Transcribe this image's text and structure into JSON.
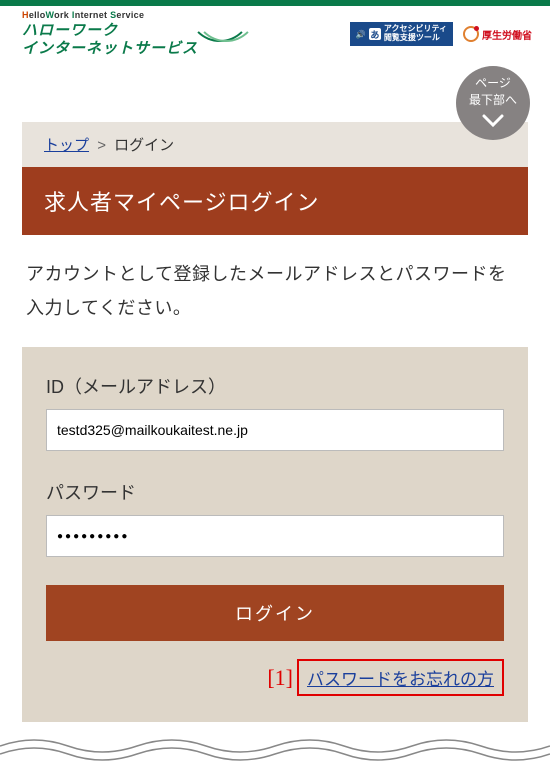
{
  "header": {
    "logo_en_raw": "HelloWork Internet Service",
    "logo_ja_line1": "ハローワーク",
    "logo_ja_line2": "インターネットサービス",
    "accessibility_icon": "あ",
    "accessibility_line1": "アクセシビリティ",
    "accessibility_line2": "閲覧支援ツール",
    "mhlw_label": "厚生労働省"
  },
  "scroll_badge": {
    "line1": "ページ",
    "line2": "最下部へ"
  },
  "breadcrumb": {
    "home_label": "トップ",
    "sep": ">",
    "current": "ログイン"
  },
  "page_title": "求人者マイページログイン",
  "intro": "アカウントとして登録したメールアドレスとパスワードを入力してください。",
  "form": {
    "id_label": "ID（メールアドレス）",
    "id_value": "testd325@mailkoukaitest.ne.jp",
    "password_label": "パスワード",
    "password_display": "●●●●●●●●●",
    "login_button": "ログイン",
    "forgot_link": "パスワードをお忘れの方"
  },
  "annotation": {
    "marker": "[1]"
  },
  "colors": {
    "brand_green": "#0a7a4a",
    "title_brown": "#9e3d1e",
    "button_brown": "#a04421",
    "panel_beige": "#ded6c9",
    "breadcrumb_beige": "#e8e3dc",
    "link_blue": "#1a3f9c",
    "annotation_red": "#e00000"
  }
}
